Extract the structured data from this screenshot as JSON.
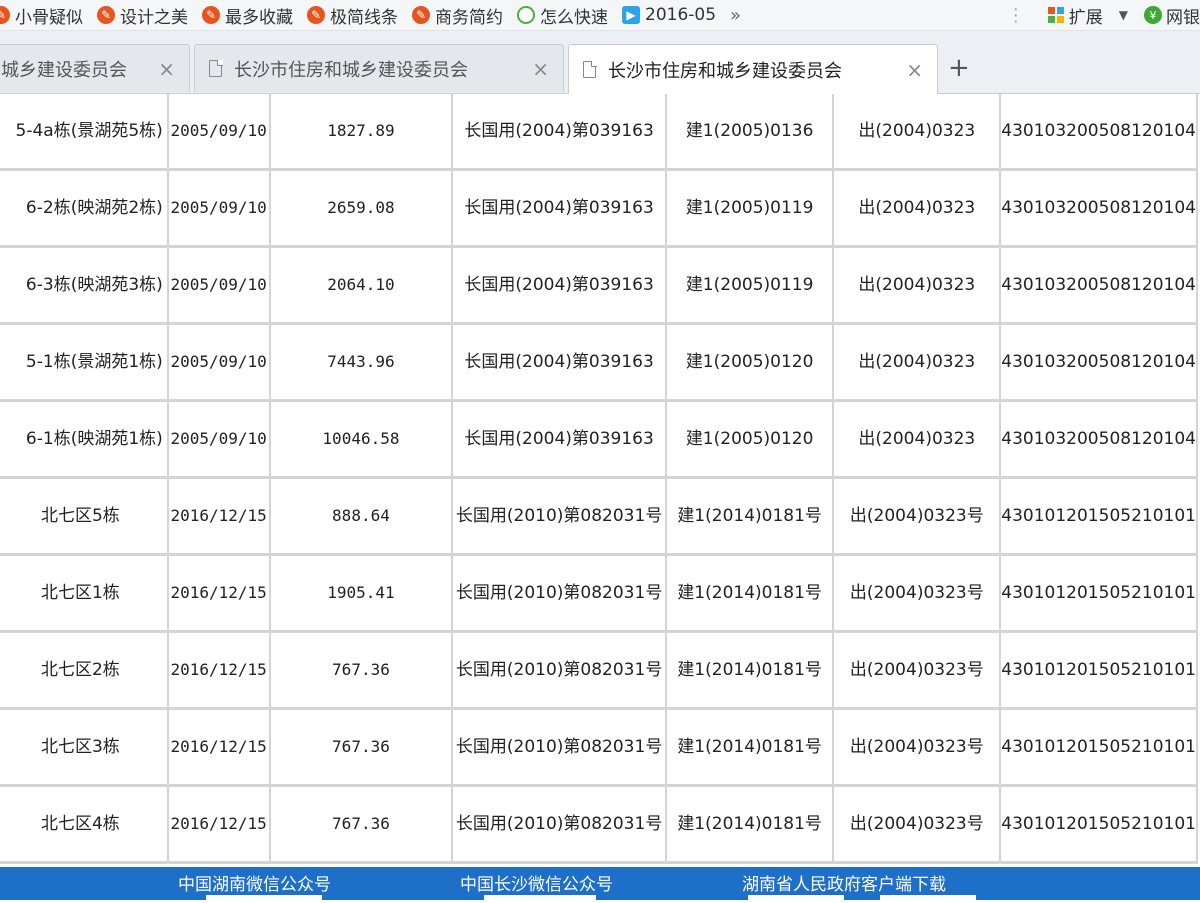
{
  "bookmarks": [
    {
      "label": "小骨疑似",
      "icon": "bookmark-icon"
    },
    {
      "label": "设计之美",
      "icon": "bookmark-icon"
    },
    {
      "label": "最多收藏",
      "icon": "bookmark-icon"
    },
    {
      "label": "极简线条",
      "icon": "bookmark-icon"
    },
    {
      "label": "商务简约",
      "icon": "bookmark-icon"
    },
    {
      "label": "怎么快速",
      "icon": "search-circle-icon"
    },
    {
      "label": "2016-05",
      "icon": "video-icon"
    }
  ],
  "bookmarks_more": "»",
  "extensions_label": "扩展",
  "netbank_label": "网银",
  "tabs": [
    {
      "title": "城乡建设委员会",
      "close": "×"
    },
    {
      "title": "长沙市住房和城乡建设委员会",
      "close": "×"
    },
    {
      "title": "长沙市住房和城乡建设委员会",
      "close": "×"
    }
  ],
  "new_tab": "+",
  "rows": [
    [
      "5-4a栋(景湖苑5栋)",
      "2005/09/10",
      "1827.89",
      "长国用(2004)第039163",
      "建1(2005)0136",
      "出(2004)0323",
      "430103200508120104"
    ],
    [
      "6-2栋(映湖苑2栋)",
      "2005/09/10",
      "2659.08",
      "长国用(2004)第039163",
      "建1(2005)0119",
      "出(2004)0323",
      "430103200508120104"
    ],
    [
      "6-3栋(映湖苑3栋)",
      "2005/09/10",
      "2064.10",
      "长国用(2004)第039163",
      "建1(2005)0119",
      "出(2004)0323",
      "430103200508120104"
    ],
    [
      "5-1栋(景湖苑1栋)",
      "2005/09/10",
      "7443.96",
      "长国用(2004)第039163",
      "建1(2005)0120",
      "出(2004)0323",
      "430103200508120104"
    ],
    [
      "6-1栋(映湖苑1栋)",
      "2005/09/10",
      "10046.58",
      "长国用(2004)第039163",
      "建1(2005)0120",
      "出(2004)0323",
      "430103200508120104"
    ],
    [
      "北七区5栋",
      "2016/12/15",
      "888.64",
      "长国用(2010)第082031号",
      "建1(2014)0181号",
      "出(2004)0323号",
      "430101201505210101"
    ],
    [
      "北七区1栋",
      "2016/12/15",
      "1905.41",
      "长国用(2010)第082031号",
      "建1(2014)0181号",
      "出(2004)0323号",
      "430101201505210101"
    ],
    [
      "北七区2栋",
      "2016/12/15",
      "767.36",
      "长国用(2010)第082031号",
      "建1(2014)0181号",
      "出(2004)0323号",
      "430101201505210101"
    ],
    [
      "北七区3栋",
      "2016/12/15",
      "767.36",
      "长国用(2010)第082031号",
      "建1(2014)0181号",
      "出(2004)0323号",
      "430101201505210101"
    ],
    [
      "北七区4栋",
      "2016/12/15",
      "767.36",
      "长国用(2010)第082031号",
      "建1(2014)0181号",
      "出(2004)0323号",
      "430101201505210101"
    ]
  ],
  "footer": {
    "wechat_hunan": "中国湖南微信公众号",
    "wechat_changsha": "中国长沙微信公众号",
    "app_download": "湖南省人民政府客户端下载"
  },
  "colors": {
    "footer_bg": "#1e6fc8",
    "bookmark_icon": "#e8541f",
    "grid_border": "#d4d4d4"
  }
}
